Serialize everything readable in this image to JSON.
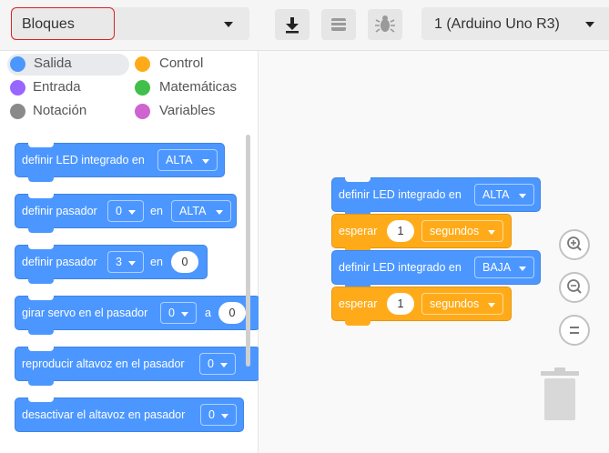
{
  "toolbar": {
    "mode_label": "Bloques",
    "device_label": "1 (Arduino Uno R3)"
  },
  "categories": [
    {
      "label": "Salida",
      "color": "#4c97ff"
    },
    {
      "label": "Control",
      "color": "#ffab19"
    },
    {
      "label": "Entrada",
      "color": "#9966ff"
    },
    {
      "label": "Matemáticas",
      "color": "#40bf4a"
    },
    {
      "label": "Notación",
      "color": "#8a8a8a"
    },
    {
      "label": "Variables",
      "color": "#cf63cf"
    }
  ],
  "palette_blocks": [
    {
      "text": "definir LED integrado en",
      "dd": "ALTA"
    },
    {
      "text": "definir pasador",
      "dd1": "0",
      "mid": "en",
      "dd2": "ALTA"
    },
    {
      "text": "definir pasador",
      "dd1": "3",
      "mid": "en",
      "num": "0"
    },
    {
      "text": "girar servo en el pasador",
      "dd1": "0",
      "mid": "a",
      "num": "0"
    },
    {
      "text": "reproducir altavoz en el pasador",
      "dd1": "0"
    },
    {
      "text": "desactivar el altavoz en pasador",
      "dd1": "0"
    }
  ],
  "script_blocks": [
    {
      "text": "definir LED integrado en",
      "dd": "ALTA"
    },
    {
      "text": "esperar",
      "num": "1",
      "dd": "segundos"
    },
    {
      "text": "definir LED integrado en",
      "dd": "BAJA"
    },
    {
      "text": "esperar",
      "num": "1",
      "dd": "segundos"
    }
  ],
  "colors": {
    "blue_block": "#4c97ff",
    "orange_block": "#ffab19"
  }
}
